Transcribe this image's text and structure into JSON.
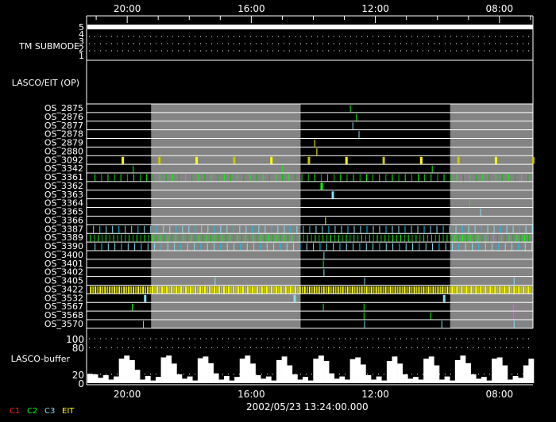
{
  "chart_data": {
    "type": "timeline",
    "time_axis": {
      "start_hour": 21.31,
      "end_hour": 6.92,
      "reversed": true,
      "major_ticks": [
        20,
        16,
        12,
        8
      ],
      "major_labels": [
        "20:00",
        "16:00",
        "12:00",
        "08:00"
      ],
      "minor_step_hours": 1
    },
    "date_label": "2002/05/23 13:24:00.000",
    "tm_submode": {
      "label": "TM SUBMODE",
      "levels": [
        "5",
        "4",
        "3",
        "2",
        "1"
      ],
      "value": 5
    },
    "op_panel": {
      "label": "LASCO/EIT (OP)"
    },
    "shaded_intervals": [
      [
        19.23,
        14.41
      ],
      [
        9.59,
        6.92
      ]
    ],
    "colors": {
      "C1": "#ff2020",
      "C2": "#00ff00",
      "C2d": "#00c000",
      "C3": "#80e0f0",
      "C3b": "#00c8ff",
      "EIT": "#ffff00",
      "EITd": "#c8c800",
      "shade": "#848484"
    },
    "rows": [
      {
        "label": "OS_2875",
        "color": "C2",
        "events": [
          12.82
        ]
      },
      {
        "label": "OS_2876",
        "color": "C2",
        "events": [
          12.62
        ]
      },
      {
        "label": "OS_2877",
        "color": "C3",
        "events": [
          12.74
        ]
      },
      {
        "label": "OS_2878",
        "color": "C3",
        "events": [
          12.54
        ]
      },
      {
        "label": "OS_2879",
        "color": "EIT",
        "events": [
          13.97
        ]
      },
      {
        "label": "OS_2880",
        "color": "EIT",
        "events": [
          13.9
        ]
      },
      {
        "label": "OS_3092",
        "color": "EIT",
        "wide": true,
        "events": [
          20.18,
          19.0,
          17.8,
          16.59,
          15.39,
          14.18,
          12.97,
          11.77,
          10.56,
          9.36,
          8.15,
          6.95
        ]
      },
      {
        "label": "OS_3342",
        "color": "C2",
        "wide": false,
        "events": [
          19.82,
          15.0,
          10.18
        ]
      },
      {
        "label": "OS_3361",
        "color": "C2",
        "periodic": {
          "start": 21.05,
          "end": 6.95,
          "step_min": 12.5
        }
      },
      {
        "label": "OS_3362",
        "color": "C2",
        "wide": true,
        "events": [
          13.77
        ]
      },
      {
        "label": "OS_3363",
        "color": "C3",
        "wide": true,
        "events": [
          13.41
        ]
      },
      {
        "label": "OS_3364",
        "color": "C2",
        "events": [
          8.97
        ]
      },
      {
        "label": "OS_3365",
        "color": "C3",
        "events": [
          8.62
        ]
      },
      {
        "label": "OS_3366",
        "color": "EIT",
        "events": [
          13.62
        ]
      },
      {
        "label": "OS_3387",
        "color": "C3",
        "periodic": {
          "start": 21.1,
          "end": 6.95,
          "step_min": 12.3
        }
      },
      {
        "label": "OS_3389",
        "color": "C2",
        "periodic": {
          "start": 21.2,
          "end": 6.95,
          "step_min": 7.5
        }
      },
      {
        "label": "OS_3390",
        "color": "C3",
        "periodic": {
          "start": 21.05,
          "end": 6.95,
          "step_min": 12.8
        }
      },
      {
        "label": "OS_3400",
        "color": "C3",
        "events": [
          13.67
        ]
      },
      {
        "label": "OS_3401",
        "color": "C2",
        "events": [
          13.69
        ]
      },
      {
        "label": "OS_3402",
        "color": "C3",
        "events": [
          13.67
        ]
      },
      {
        "label": "OS_3405",
        "color": "C3",
        "events": [
          17.18,
          12.36,
          7.54
        ]
      },
      {
        "label": "OS_3422",
        "color": "EIT",
        "periodic": {
          "start": 21.2,
          "end": 6.95,
          "step_min": 4.6
        }
      },
      {
        "label": "OS_3532",
        "color": "C3",
        "wide": true,
        "events": [
          19.46,
          14.64,
          9.82
        ]
      },
      {
        "label": "OS_3567",
        "color": "C2",
        "events": [
          19.85,
          13.69,
          12.38,
          7.56
        ]
      },
      {
        "label": "OS_3568",
        "color": "C2",
        "events": [
          12.38,
          10.23,
          7.56
        ]
      },
      {
        "label": "OS_3570",
        "color": "C3",
        "events": [
          19.49,
          12.36,
          9.87,
          7.54
        ]
      }
    ],
    "buffer": {
      "label": "LASCO-buffer",
      "y_ticks": [
        "100",
        "80",
        "20",
        "0"
      ],
      "y_tick_values": [
        100,
        80,
        20,
        0
      ],
      "ylim": [
        0,
        100
      ],
      "values": [
        21,
        20,
        12,
        18,
        8,
        15,
        55,
        62,
        52,
        30,
        8,
        16,
        6,
        14,
        58,
        62,
        44,
        20,
        10,
        15,
        6,
        56,
        60,
        45,
        22,
        8,
        16,
        6,
        14,
        55,
        62,
        44,
        18,
        10,
        15,
        6,
        52,
        60,
        40,
        20,
        8,
        14,
        6,
        55,
        62,
        50,
        22,
        10,
        15,
        8,
        54,
        58,
        42,
        18,
        8,
        15,
        6,
        50,
        60,
        44,
        20,
        10,
        14,
        8,
        55,
        60,
        40,
        8,
        15,
        6,
        52,
        62,
        45,
        20,
        10,
        14,
        6,
        55,
        58,
        40,
        8,
        16,
        12,
        40,
        55
      ]
    },
    "legend": [
      {
        "label": "C1",
        "color": "C1"
      },
      {
        "label": "C2",
        "color": "C2"
      },
      {
        "label": "C3",
        "color": "C3"
      },
      {
        "label": "EIT",
        "color": "EIT"
      }
    ]
  }
}
